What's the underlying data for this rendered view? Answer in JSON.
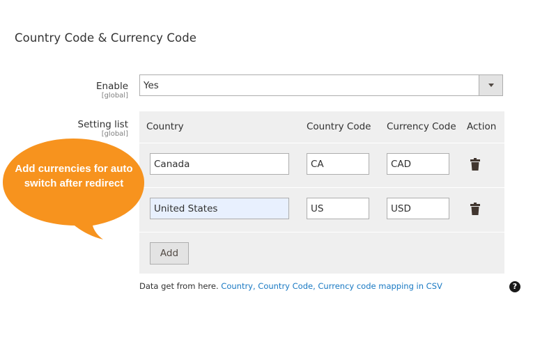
{
  "section": {
    "title": "Country Code & Currency Code"
  },
  "enable": {
    "label": "Enable",
    "scope": "[global]",
    "value": "Yes"
  },
  "setting_list": {
    "label": "Setting list",
    "scope": "[global]",
    "columns": [
      "Country",
      "Country Code",
      "Currency Code",
      "Action"
    ],
    "rows": [
      {
        "country": "Canada",
        "country_code": "CA",
        "currency_code": "CAD",
        "action_icon": "trash-icon"
      },
      {
        "country": "United States",
        "country_code": "US",
        "currency_code": "USD",
        "action_icon": "trash-icon"
      }
    ],
    "add_label": "Add"
  },
  "note": {
    "prefix": "Data get from here. ",
    "link": "Country, Country Code, Currency code mapping in CSV"
  },
  "help_icon": "?",
  "callout": {
    "text": "Add currencies for auto switch after redirect",
    "color": "#f7931e"
  },
  "colors": {
    "link": "#1979c3",
    "grid_bg": "#efefef",
    "focus_bg": "#e8f0fe"
  }
}
